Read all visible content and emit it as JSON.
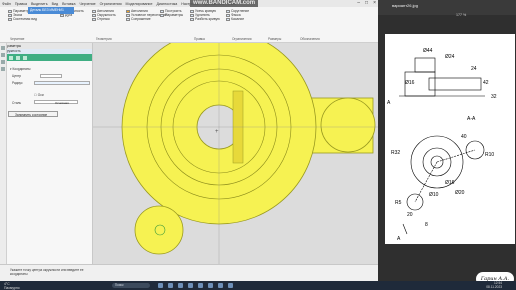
{
  "watermark": "www.BANDICAM.com",
  "menu": [
    "Файл",
    "Правка",
    "Выделить",
    "Вид",
    "Вставка",
    "Черчение",
    "Ограничения",
    "Моделирование",
    "Диагностика",
    "Настройки",
    "Приложения",
    "Окно",
    "Справка"
  ],
  "doc_tab": "Деталь БЕЗ ИМЕНИ1",
  "ribbon": {
    "group1": [
      "Параметрический режим",
      "Эскиз",
      "Системная вид"
    ],
    "group1_label": "Системная",
    "group2": [
      "Окружность",
      "Дуга"
    ],
    "group3": [
      "Автолиния",
      "Окружность",
      "Отрезок"
    ],
    "group4": [
      "Автолиния",
      "Условное пересечение",
      "Сопряжение"
    ],
    "group4b": [
      "Построить",
      "Параметры"
    ],
    "group5": [
      "Усечь кривую",
      "Удлинить",
      "Разбить кривую"
    ],
    "group5_label": "Правка",
    "group6": [
      "Скругление",
      "Фаска",
      "Касание"
    ],
    "group7_label": "Размеры",
    "ribbon_labels": [
      "Черчение",
      "Геометрия",
      "Правка",
      "Ограничения",
      "Размеры",
      "Обозначения"
    ]
  },
  "left_panel": {
    "title": "Параметры",
    "tab": "Окружность",
    "section": "Координаты",
    "center_label": "Центр",
    "radius_label": "Радиус",
    "axes_label": "Оси",
    "style_label": "Стиль",
    "style_value": "Основная",
    "btn_label": "Запомнить состояние"
  },
  "status_text": "Укажите точку центра окружности или введите ее координаты",
  "right_panel": {
    "title": "вариант26.jpg",
    "zoom": "177 %"
  },
  "drawing_dims": [
    "Ø44",
    "Ø24",
    "Ø16",
    "42",
    "32",
    "24",
    "R32",
    "R10",
    "40",
    "Ø16",
    "20",
    "8",
    "Ø10",
    "Ø20",
    "R5",
    "A-A",
    "A",
    "A"
  ],
  "signature": "Гарин А.А.",
  "taskbar": {
    "temp": "4°C",
    "temp_sub": "Пасмурно",
    "search": "Поиск",
    "time": "12:54",
    "date": "08.11.2023"
  },
  "colors": {
    "part_fill": "#f6f252",
    "part_stroke": "#9a9a20",
    "accent": "#3fae83"
  }
}
